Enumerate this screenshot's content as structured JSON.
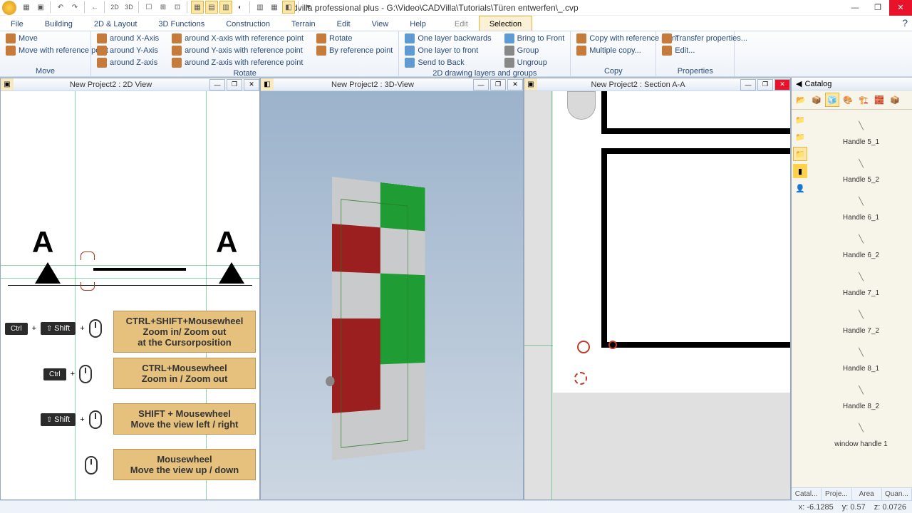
{
  "app": {
    "title": "cadvilla professional plus - G:\\Video\\CADVilla\\Tutorials\\Türen entwerfen\\_.cvp"
  },
  "tabs": {
    "file": "File",
    "building": "Building",
    "layout2d": "2D & Layout",
    "functions3d": "3D Functions",
    "construction": "Construction",
    "terrain": "Terrain",
    "edit": "Edit",
    "view": "View",
    "help": "Help",
    "edit2": "Edit",
    "selection": "Selection"
  },
  "ribbon": {
    "move": {
      "title": "Move",
      "items": [
        "Move",
        "Move with reference point"
      ]
    },
    "rotate": {
      "title": "Rotate",
      "col1": [
        "around X-Axis",
        "around Y-Axis",
        "around Z-axis"
      ],
      "col2": [
        "around X-axis with reference point",
        "around Y-axis with reference point",
        "around Z-axis with reference point"
      ],
      "col3": [
        "Rotate",
        "By reference point"
      ]
    },
    "layers": {
      "title": "2D drawing layers and groups",
      "col1": [
        "One layer backwards",
        "One layer to front",
        "Send to Back"
      ],
      "col2": [
        "Bring to Front",
        "Group",
        "Ungroup"
      ]
    },
    "copy": {
      "title": "Copy",
      "items": [
        "Copy with reference point",
        "Multiple copy..."
      ]
    },
    "props": {
      "title": "Properties",
      "items": [
        "Transfer properties...",
        "Edit..."
      ]
    }
  },
  "panes": {
    "view2d": "New Project2 : 2D View",
    "view3d": "New Project2 : 3D-View",
    "section": "New Project2 : Section A-A"
  },
  "hints": {
    "h1": "CTRL+SHIFT+Mousewheel\nZoom in/ Zoom out\nat the Cursorposition",
    "h2": "CTRL+Mousewheel\nZoom in / Zoom out",
    "h3": "SHIFT + Mousewheel\nMove the view left / right",
    "h4": "Mousewheel\nMove the view up / down",
    "ctrl": "Ctrl",
    "shift": "Shift"
  },
  "section_label": "A",
  "catalog": {
    "title": "Catalog",
    "items": [
      "Handle 5_1",
      "Handle 5_2",
      "Handle 6_1",
      "Handle 6_2",
      "Handle 7_1",
      "Handle 7_2",
      "Handle 8_1",
      "Handle 8_2",
      "window handle 1"
    ],
    "foot": [
      "Catal...",
      "Proje...",
      "Area",
      "Quan..."
    ]
  },
  "status": {
    "x": "x: -6.1285",
    "y": "y: 0.57",
    "z": "z: 0.0726"
  }
}
